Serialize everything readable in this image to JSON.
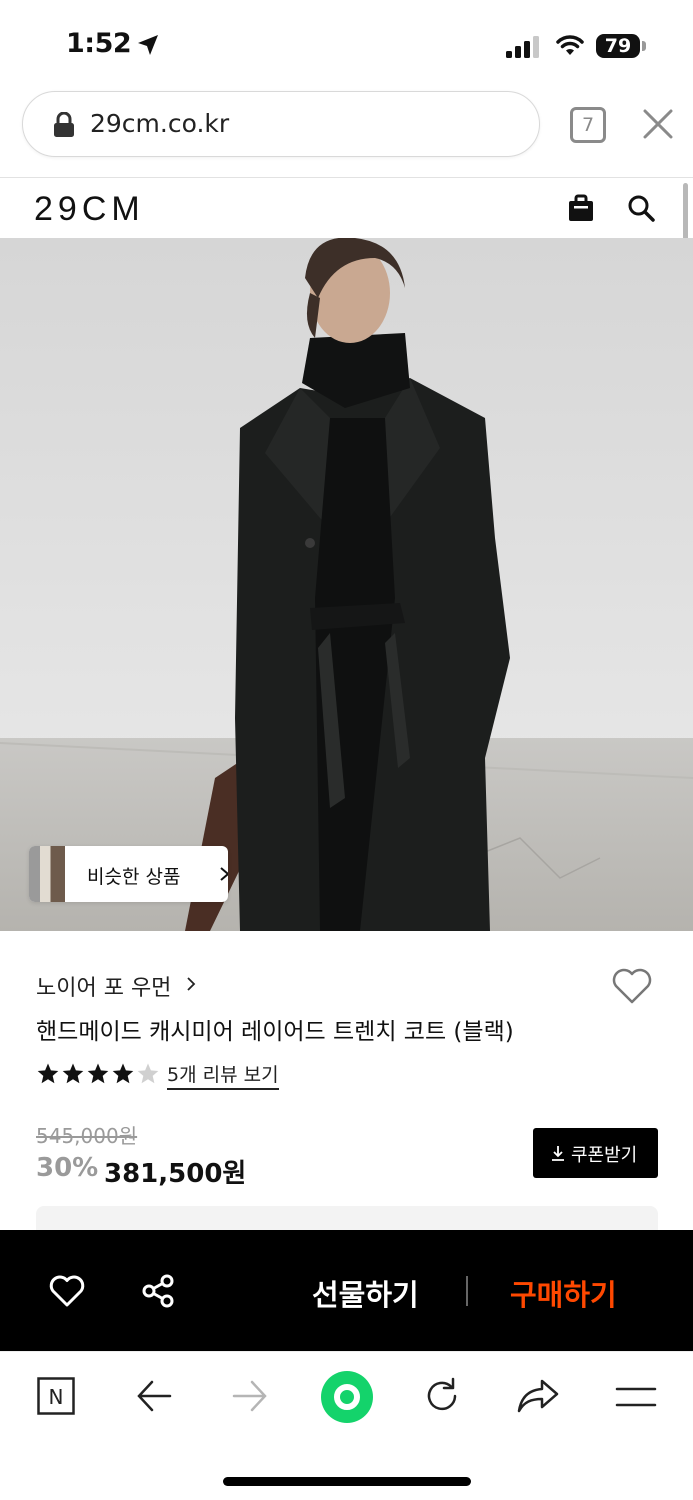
{
  "status_bar": {
    "time": "1:52",
    "battery": "79"
  },
  "browser": {
    "url": "29cm.co.kr",
    "tab_count": "7"
  },
  "site": {
    "logo": "29CM"
  },
  "hero": {
    "similar_button_label": "비슷한 상품"
  },
  "product": {
    "brand": "노이어 포 우먼",
    "name": "핸드메이드 캐시미어 레이어드 트렌치 코트 (블랙)",
    "rating": 4.5,
    "review_link": "5개 리뷰 보기",
    "original_price": "545,000원",
    "discount": "30%",
    "sale_price": "381,500원",
    "coupon_button": "쿠폰받기"
  },
  "purchase_bar": {
    "gift_label": "선물하기",
    "buy_label": "구매하기",
    "accent_color": "#ff4800"
  },
  "toolbar": {
    "home_icon_letter": "N",
    "green_button_color": "#14d36b"
  },
  "icons": [
    "location-arrow-icon",
    "signal-icon",
    "wifi-icon",
    "lock-icon",
    "close-icon",
    "shopping-bag-icon",
    "search-icon",
    "chevron-right-icon",
    "heart-icon",
    "star-icon",
    "download-icon",
    "share-icon",
    "back-arrow-icon",
    "forward-arrow-icon",
    "refresh-icon",
    "share-arrow-icon",
    "menu-icon"
  ]
}
